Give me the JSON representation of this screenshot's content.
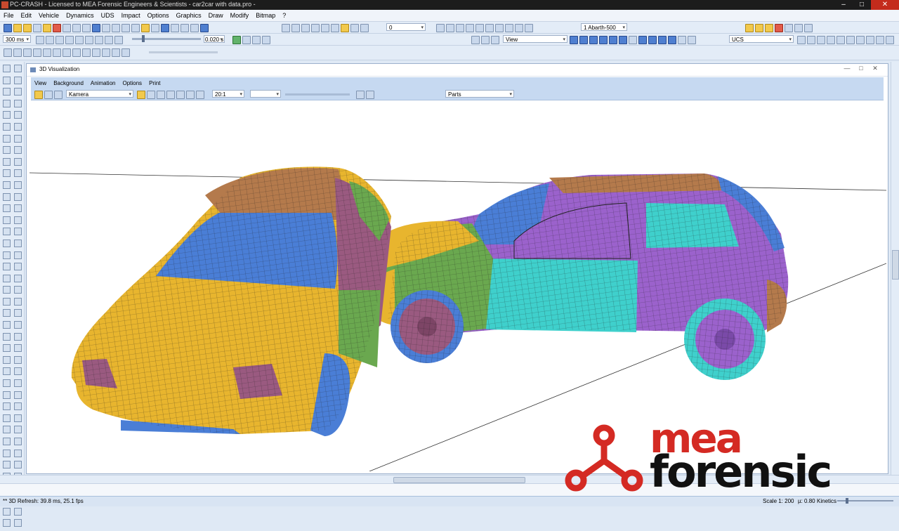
{
  "titlebar": {
    "title": "PC-CRASH - Licensed to MEA Forensic Engineers & Scientists - car2car with data.pro -",
    "controls": [
      "–",
      "□",
      "✕"
    ]
  },
  "menubar": {
    "items": [
      "File",
      "Edit",
      "Vehicle",
      "Dynamics",
      "UDS",
      "Impact",
      "Options",
      "Graphics",
      "Draw",
      "Modify",
      "Bitmap",
      "?"
    ]
  },
  "toolbar": {
    "time_step": "300 ms",
    "layer_value": "0",
    "time_value": "0.020 s",
    "vehicle_select": "1  Abarth-500",
    "view_select": "View",
    "ucs_select": "UCS"
  },
  "viz_window": {
    "title": "3D Visualization",
    "menu": [
      "View",
      "Background",
      "Animation",
      "Options",
      "Print"
    ],
    "camera_select": "Kamera",
    "scale_select": "20:1",
    "parts_select": "Parts",
    "controls": [
      "—",
      "□",
      "✕"
    ]
  },
  "statusbar": {
    "left": "** 3D Refresh: 39.8 ms, 25.1 fps",
    "scale": "Scale 1: 200",
    "mu": "µ: 0.80",
    "mode": "Kinetics"
  },
  "logo": {
    "line1": "mea",
    "line2": "forensic"
  },
  "colors": {
    "yellow": "#e8b52e",
    "blue": "#4a7ed6",
    "purple": "#9b62cc",
    "brown": "#b47a4c",
    "green": "#6aa84f",
    "teal": "#3fd0cc",
    "mauve": "#9a5a80",
    "brand_red": "#d42a23"
  }
}
